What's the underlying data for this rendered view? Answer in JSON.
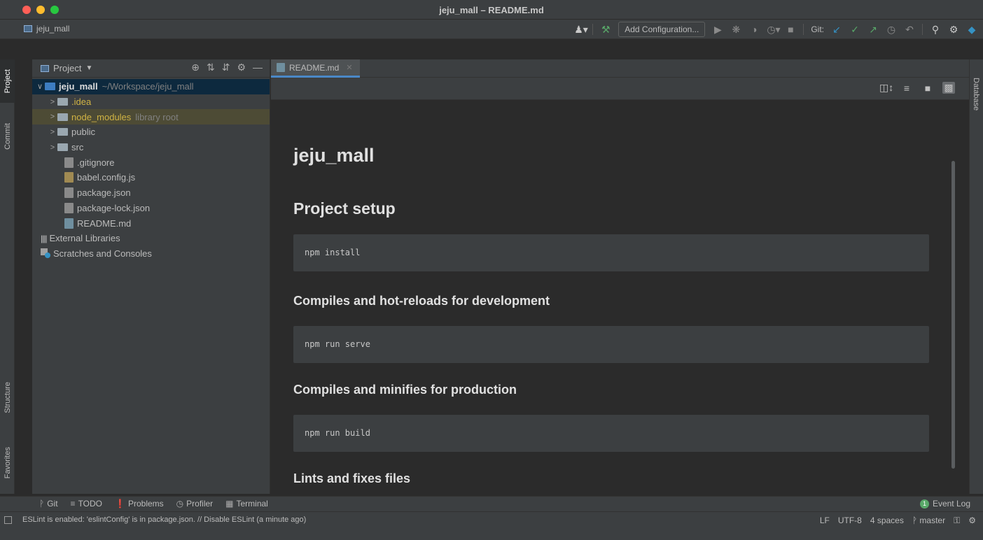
{
  "window": {
    "title": "jeju_mall – README.md"
  },
  "navbar": {
    "project_name": "jeju_mall",
    "add_configuration": "Add Configuration...",
    "git_label": "Git:"
  },
  "left_strip": {
    "project": "Project",
    "commit": "Commit",
    "structure": "Structure",
    "favorites": "Favorites"
  },
  "right_strip": {
    "database": "Database"
  },
  "project_panel": {
    "title": "Project",
    "root": {
      "name": "jeju_mall",
      "path": "~/Workspace/jeju_mall"
    },
    "items": [
      {
        "name": ".idea"
      },
      {
        "name": "node_modules",
        "note": "library root"
      },
      {
        "name": "public"
      },
      {
        "name": "src"
      },
      {
        "name": ".gitignore"
      },
      {
        "name": "babel.config.js"
      },
      {
        "name": "package.json"
      },
      {
        "name": "package-lock.json"
      },
      {
        "name": "README.md"
      },
      {
        "name": "External Libraries"
      },
      {
        "name": "Scratches and Consoles"
      }
    ]
  },
  "editor": {
    "tab": "README.md",
    "preview": {
      "h1": "jeju_mall",
      "h2": "Project setup",
      "code1": "npm install",
      "h3a": "Compiles and hot-reloads for development",
      "code2": "npm run serve",
      "h3b": "Compiles and minifies for production",
      "code3": "npm run build",
      "h3c": "Lints and fixes files"
    }
  },
  "bottom_tools": {
    "git": "Git",
    "todo": "TODO",
    "problems": "Problems",
    "profiler": "Profiler",
    "terminal": "Terminal",
    "event_log": "Event Log",
    "event_count": "1"
  },
  "status": {
    "message": "ESLint is enabled: 'eslintConfig' is in package.json. // Disable ESLint (a minute ago)",
    "line_sep": "LF",
    "encoding": "UTF-8",
    "indent": "4 spaces",
    "branch": "master"
  }
}
